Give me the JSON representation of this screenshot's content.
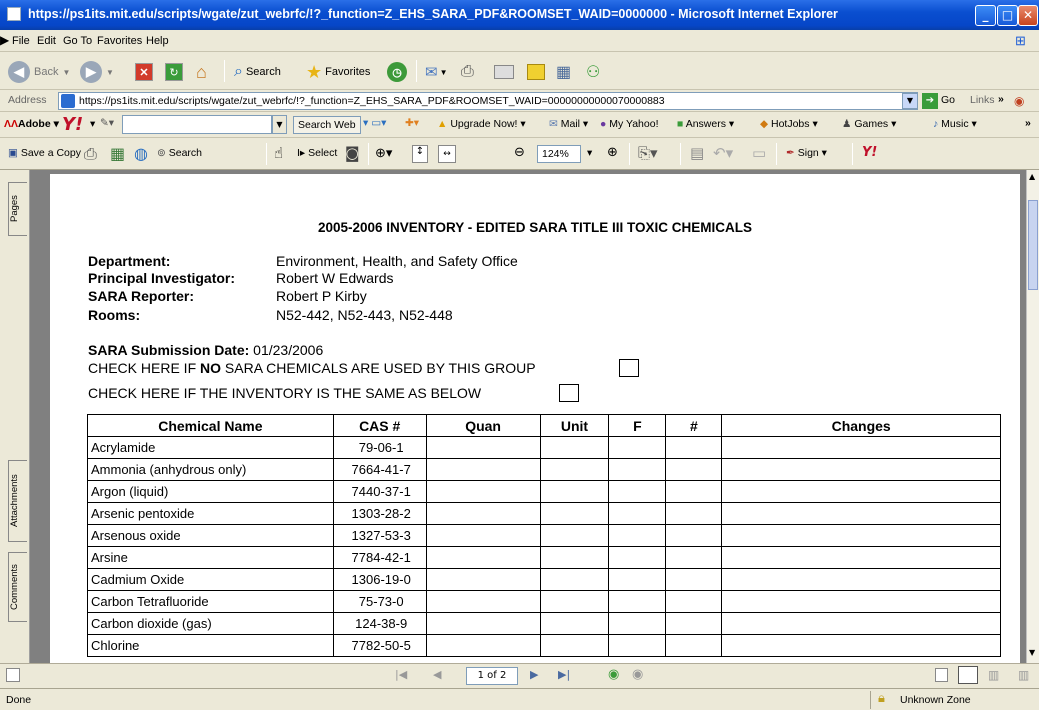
{
  "window": {
    "title": "https://ps1its.mit.edu/scripts/wgate/zut_webrfc/!?_function=Z_EHS_SARA_PDF&ROOMSET_WAID=0000000 - Microsoft Internet Explorer",
    "controls": {
      "minimize": "_",
      "maximize": "□",
      "close": "✕"
    }
  },
  "menu": [
    "File",
    "Edit",
    "Go To",
    "Favorites",
    "Help"
  ],
  "toolbar": {
    "back": "Back",
    "search": "Search",
    "favorites": "Favorites"
  },
  "address": {
    "label": "Address",
    "url": "https://ps1its.mit.edu/scripts/wgate/zut_webrfc/!?_function=Z_EHS_SARA_PDF&ROOMSET_WAID=00000000000070000883",
    "go": "Go",
    "links": "Links"
  },
  "links_bar": {
    "adobe": "Adobe",
    "search_web": "Search Web",
    "upgrade": "Upgrade Now!",
    "mail": "Mail",
    "my_yahoo": "My Yahoo!",
    "answers": "Answers",
    "hotjobs": "HotJobs",
    "games": "Games",
    "music": "Music"
  },
  "pdf_toolbar": {
    "save_copy": "Save a Copy",
    "search": "Search",
    "select": "Select",
    "zoom": "124%",
    "sign": "Sign"
  },
  "side_tabs": {
    "pages": "Pages",
    "attachments": "Attachments",
    "comments": "Comments"
  },
  "document": {
    "title": "2005-2006 INVENTORY - EDITED SARA TITLE III TOXIC CHEMICALS",
    "fields": [
      {
        "label": "Department:",
        "value": "Environment, Health, and Safety Office"
      },
      {
        "label": "Principal Investigator:",
        "value": "Robert W Edwards"
      },
      {
        "label": "SARA Reporter:",
        "value": "Robert P Kirby"
      },
      {
        "label": "Rooms:",
        "value": "N52-442, N52-443, N52-448"
      }
    ],
    "submission_label": "SARA Submission Date:",
    "submission_date": "01/23/2006",
    "check1_pre": "CHECK HERE IF ",
    "check1_bold": "NO",
    "check1_post": " SARA CHEMICALS ARE USED BY THIS GROUP",
    "check2": "CHECK HERE IF THE INVENTORY IS THE SAME AS BELOW",
    "columns": [
      "Chemical Name",
      "CAS #",
      "Quan",
      "Unit",
      "F",
      "#",
      "Changes"
    ],
    "rows": [
      {
        "name": "Acrylamide",
        "cas": "79-06-1"
      },
      {
        "name": "Ammonia (anhydrous only)",
        "cas": "7664-41-7"
      },
      {
        "name": "Argon (liquid)",
        "cas": "7440-37-1"
      },
      {
        "name": "Arsenic pentoxide",
        "cas": "1303-28-2"
      },
      {
        "name": "Arsenous oxide",
        "cas": "1327-53-3"
      },
      {
        "name": "Arsine",
        "cas": "7784-42-1"
      },
      {
        "name": "Cadmium Oxide",
        "cas": "1306-19-0"
      },
      {
        "name": "Carbon Tetrafluoride",
        "cas": "75-73-0"
      },
      {
        "name": "Carbon dioxide (gas)",
        "cas": "124-38-9"
      },
      {
        "name": "Chlorine",
        "cas": "7782-50-5"
      }
    ]
  },
  "nav": {
    "page": "1 of 2"
  },
  "status": {
    "left": "Done",
    "zone": "Unknown Zone"
  },
  "colors": {
    "titlebar": "#0a4fd0",
    "chrome": "#ece9d8",
    "page": "#ffffff"
  }
}
